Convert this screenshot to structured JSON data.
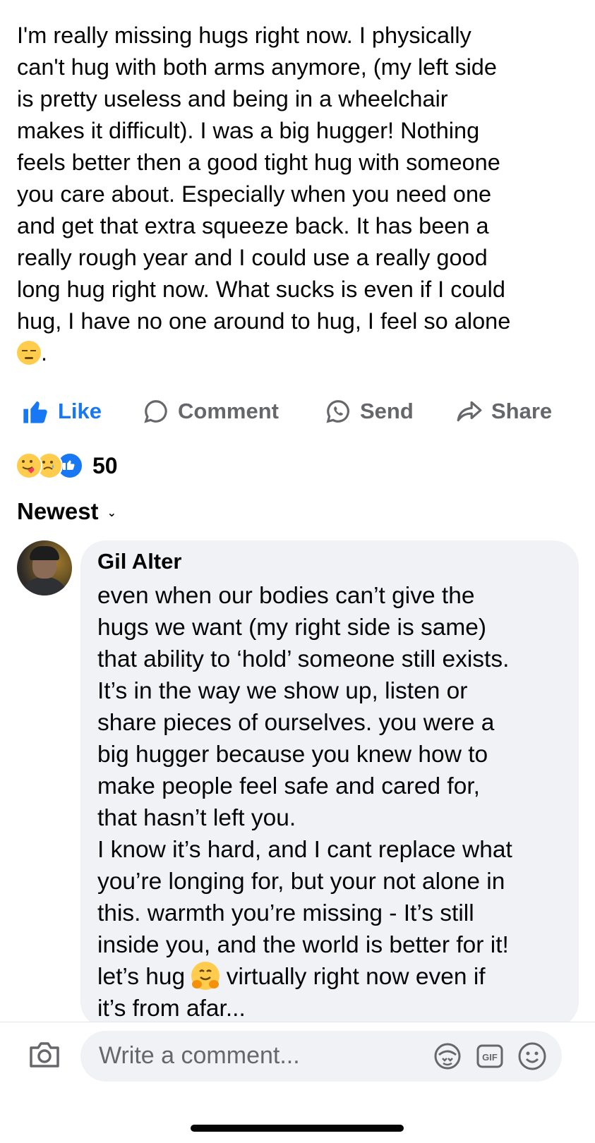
{
  "post": {
    "text": "I'm really missing hugs right now. I physically\ncan't hug with both arms anymore, (my left side\nis pretty useless and being in a wheelchair\nmakes it difficult). I was a big hugger!  Nothing\nfeels better then a good tight hug with someone\nyou care about. Especially when you need one\nand get that extra squeeze back.  It has been a\nreally rough year and I could use a really good\nlong hug right now. What sucks is even if I could\nhug, I have no one around to hug, I feel so alone\n",
    "trailing": ".",
    "emoji": "pensive-face"
  },
  "actions": {
    "like": "Like",
    "comment": "Comment",
    "send": "Send",
    "share": "Share"
  },
  "reactions": {
    "types": [
      "care",
      "sad",
      "like"
    ],
    "count": "50"
  },
  "sort": {
    "label": "Newest"
  },
  "comment": {
    "author": "Gil Alter",
    "text_before_emoji": "even when our bodies can’t give the\nhugs we want (my right side is same)\nthat ability to ‘hold’ someone still exists.\nIt’s in the way we show up, listen or\nshare pieces of ourselves. you were a\nbig hugger because you knew how to\nmake people feel safe and cared for,\nthat hasn’t left you.\nI know it’s hard, and I cant replace what\nyou’re longing for, but your not alone in\nthis.  warmth you’re missing - It’s still\ninside you, and the world is better for it!\nlet’s hug ",
    "emoji": "hugging-face",
    "text_after_emoji": " virtually right now even if\nit’s from afar..."
  },
  "composer": {
    "placeholder": "Write a comment...",
    "icons": [
      "camera-icon",
      "avatar-sticker-icon",
      "gif-icon",
      "emoji-icon"
    ]
  },
  "colors": {
    "like_blue": "#1877f2",
    "muted_gray": "#65676b",
    "bubble_bg": "#f0f2f5",
    "text": "#050505"
  }
}
